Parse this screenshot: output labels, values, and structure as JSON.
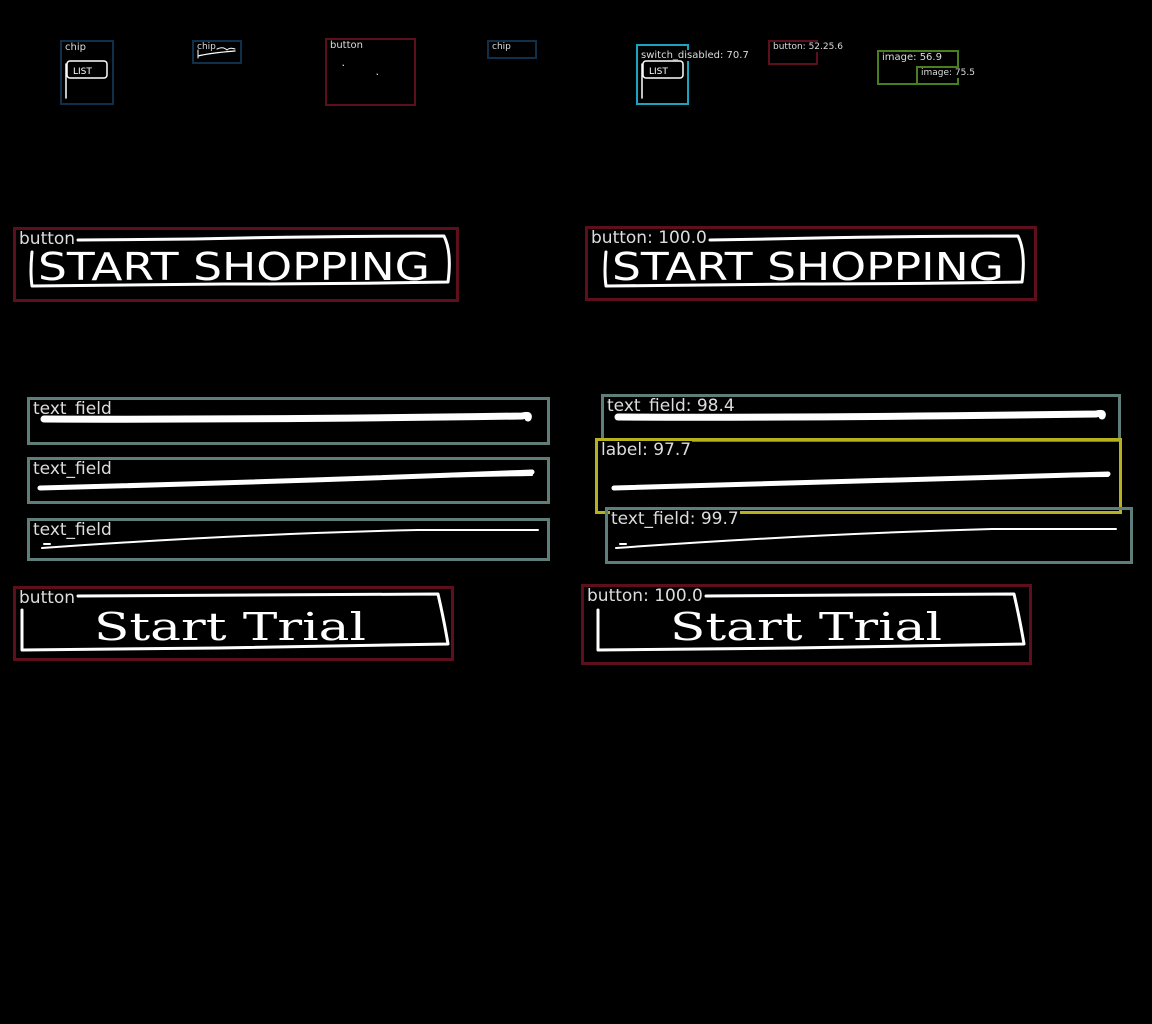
{
  "annotations": {
    "chip_1": "chip",
    "chip_2": "chip",
    "button_top_left": "button",
    "chip_3": "chip",
    "switch_disabled": "switch_disabled: 70.7",
    "button_small": "button: 52.25.6",
    "image_1": "image: 56.9",
    "image_2": "image: 75.5",
    "button_shop_left": "button",
    "button_shop_right": "button: 100.0",
    "text_field_1_left": "text_field",
    "text_field_2_left": "text_field",
    "text_field_3_left": "text_field",
    "text_field_1_right": "text_field: 98.4",
    "label_right": "label: 97.7",
    "text_field_3_right": "text_field: 99.7",
    "button_trial_left": "button",
    "button_trial_right": "button: 100.0"
  },
  "sketch_text": {
    "chip_word": "LIST",
    "shopping": "START SHOPPING",
    "trial": "Start Trial"
  },
  "colors": {
    "button": "#5e0f1c",
    "chip": "#0f3048",
    "text_field": "#5f7e7a",
    "label": "#b6b21f",
    "switch_disabled": "#1aa4bf",
    "image": "#4b7f1e",
    "sketch": "#ffffff"
  }
}
